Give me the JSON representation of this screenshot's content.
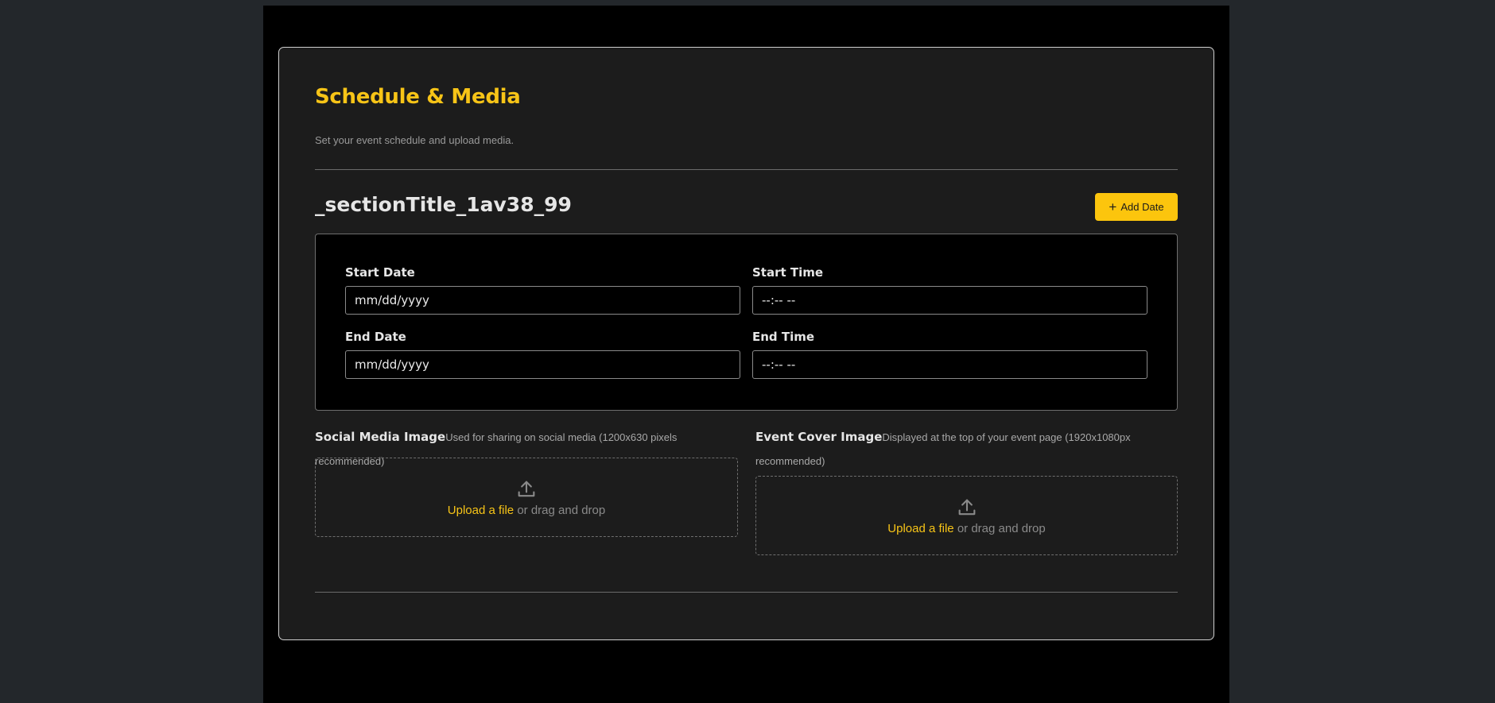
{
  "header": {
    "title": "Schedule & Media",
    "subtitle": "Set your event schedule and upload media."
  },
  "section": {
    "title": "_sectionTitle_1av38_99",
    "add_button_label": "Add Date",
    "add_button_icon": "plus-icon"
  },
  "dates": {
    "start_date": {
      "label": "Start Date",
      "placeholder": "mm/dd/yyyy"
    },
    "start_time": {
      "label": "Start Time",
      "placeholder": "--:-- --"
    },
    "end_date": {
      "label": "End Date",
      "placeholder": "mm/dd/yyyy"
    },
    "end_time": {
      "label": "End Time",
      "placeholder": "--:-- --"
    }
  },
  "media": {
    "social": {
      "label": "Social Media Image",
      "hint": "Used for sharing on social media (1200x630 pixels recommended)",
      "upload_link": "Upload a file",
      "upload_rest": " or drag and drop",
      "icon": "upload-icon"
    },
    "cover": {
      "label": "Event Cover Image",
      "hint": "Displayed at the top of your event page (1920x1080px recommended)",
      "upload_link": "Upload a file",
      "upload_rest": " or drag and drop",
      "icon": "upload-icon"
    }
  },
  "colors": {
    "accent": "#fcc50d",
    "background": "#000000",
    "card": "#1c1c1c"
  }
}
